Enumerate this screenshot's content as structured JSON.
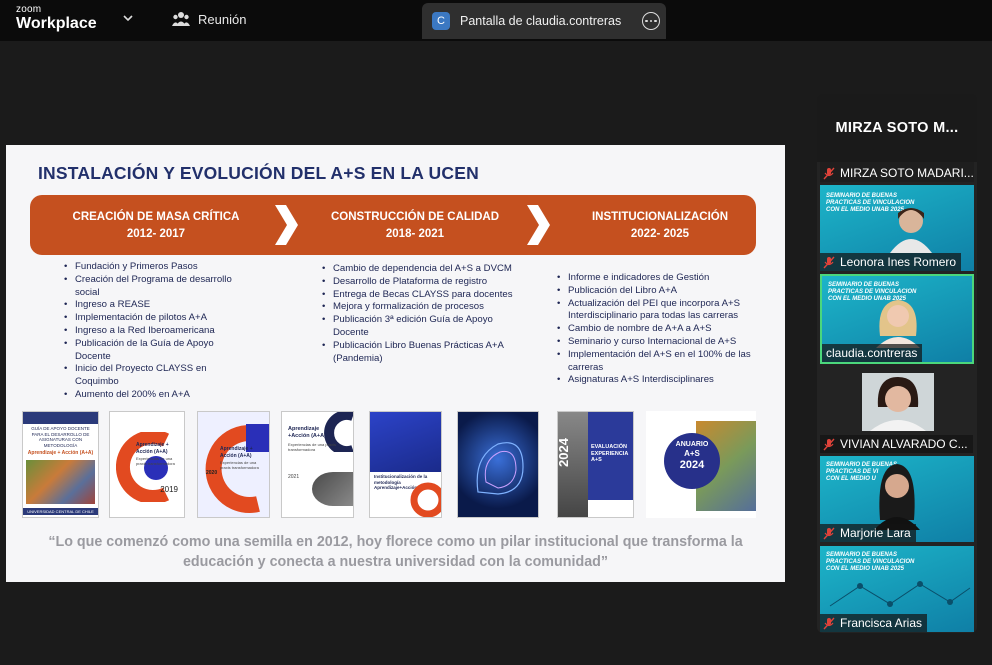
{
  "app": {
    "brand_line1": "zoom",
    "brand_line2": "Workplace"
  },
  "topbar": {
    "meeting_label": "Reunión",
    "share_tab_title": "Pantalla de claudia.contreras",
    "share_tab_avatar": "C"
  },
  "slide": {
    "title": "INSTALACIÓN Y EVOLUCIÓN DEL A+S EN LA UCEN",
    "phases": [
      {
        "title": "CREACIÓN DE MASA CRÍTICA",
        "years": "2012- 2017"
      },
      {
        "title": "CONSTRUCCIÓN DE CALIDAD",
        "years": "2018- 2021"
      },
      {
        "title": "INSTITUCIONALIZACIÓN",
        "years": "2022- 2025"
      }
    ],
    "col1": [
      "Fundación y Primeros Pasos",
      "Creación del Programa de desarrollo social",
      "Ingreso a REASE",
      "Implementación de pilotos A+A",
      "Ingreso a la Red Iberoamericana",
      "Publicación de la Guía de Apoyo Docente",
      "Inicio del Proyecto CLAYSS en Coquimbo",
      "Aumento del 200% en A+A"
    ],
    "col2": [
      "Cambio de dependencia del A+S a DVCM",
      "Desarrollo de Plataforma de registro",
      "Entrega de Becas CLAYSS para docentes",
      "Mejora y formalización de procesos",
      "Publicación 3ª edición Guía de Apoyo Docente",
      "Publicación Libro Buenas Prácticas A+A (Pandemia)"
    ],
    "col3": [
      "Informe e indicadores de Gestión",
      "Publicación del Libro A+A",
      "Actualización del PEI que incorpora A+S Interdisciplinario para todas las carreras",
      "Cambio de nombre de A+A a A+S",
      "Seminario y curso Internacional de A+S",
      "Implementación del A+S en el 100% de las carreras",
      "Asignaturas A+S Interdisciplinares"
    ],
    "covers": {
      "c1_title": "GUÍA DE APOYO DOCENTE PARA EL DESARROLLO DE ASIGNATURAS CON METODOLOGÍA",
      "c1_sub": "Aprendizaje + Acción (A+A)",
      "c1_footer": "UNIVERSIDAD CENTRAL DE CHILE",
      "c2_title": "Aprendizaje + Acción (A+A)",
      "c2_sub": "Experiencias de una praxis transformadora",
      "c2_year": "2019",
      "c3_title": "Aprendizaje + Acción (A+A)",
      "c3_sub": "Experiencias de una praxis transformadora",
      "c3_year": "2020",
      "c4_title": "Aprendizaje +Acción (A+A)",
      "c4_sub": "Experiencias de una praxis transformadora",
      "c4_year": "2021",
      "c5_title": "Institucionalización de la metodología Aprendizaje+Acción",
      "c7_year": "2024",
      "c7_title": "EVALUACIÓN EXPERIENCIA A+S",
      "c8_line1": "ANUARIO",
      "c8_line2": "A+S",
      "c8_line3": "2024"
    },
    "quote_line1": "“Lo que comenzó como una semilla en 2012,  hoy florece como un pilar institucional que transforma la",
    "quote_line2": "educación y conecta a nuestra universidad con la comunidad”"
  },
  "participants": {
    "header": "MIRZA SOTO M...",
    "list": [
      {
        "name": "MIRZA SOTO MADARI..."
      },
      {
        "name": "Leonora Ines Romero",
        "bg_line1": "SEMINARIO DE BUENAS",
        "bg_line2": "PRACTICAS DE VINCULACION",
        "bg_line3": "CON EL MEDIO UNAB 2025"
      },
      {
        "name": "claudia.contreras",
        "bg_line1": "SEMINARIO DE BUENAS",
        "bg_line2": "PRACTICAS DE VINCULACION",
        "bg_line3": "CON EL MEDIO UNAB 2025"
      },
      {
        "name": "VIVIAN ALVARADO C..."
      },
      {
        "name": "Marjorie Lara",
        "bg_line1": "SEMINARIO DE BUENAS",
        "bg_line2": "PRACTICAS DE VI",
        "bg_line3": "CON EL MEDIO U"
      },
      {
        "name": "Francisca Arias",
        "bg_line1": "SEMINARIO DE BUENAS",
        "bg_line2": "PRACTICAS DE VINCULACION",
        "bg_line3": "CON EL MEDIO UNAB 2025"
      }
    ]
  },
  "colors": {
    "accent_orange": "#c5501f",
    "title_navy": "#22306b",
    "speaker_green": "#4bd77c",
    "mic_muted": "#e0433a"
  }
}
